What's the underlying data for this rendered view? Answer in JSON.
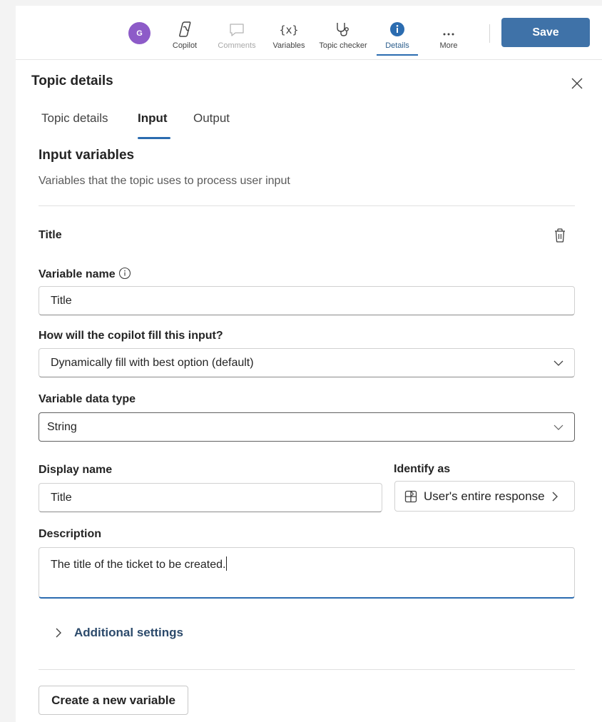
{
  "toolbar": {
    "avatar_initial": "G",
    "items": [
      {
        "label": "Copilot",
        "icon": "copilot-icon"
      },
      {
        "label": "Comments",
        "icon": "comment-icon"
      },
      {
        "label": "Variables",
        "icon": "variables-icon"
      },
      {
        "label": "Topic checker",
        "icon": "stethoscope-icon"
      },
      {
        "label": "Details",
        "icon": "info-icon"
      },
      {
        "label": "More",
        "icon": "more-icon"
      }
    ],
    "active_item": "Details",
    "disabled_item": "Comments",
    "save_label": "Save"
  },
  "panel": {
    "title": "Topic details",
    "tabs": [
      {
        "label": "Topic details"
      },
      {
        "label": "Input"
      },
      {
        "label": "Output"
      }
    ],
    "active_tab": "Input"
  },
  "input_variables": {
    "title": "Input variables",
    "description": "Variables that the topic uses to process user input"
  },
  "variable": {
    "title": "Title",
    "variable_name_label": "Variable name",
    "variable_name_value": "Title",
    "fill_label": "How will the copilot fill this input?",
    "fill_value": "Dynamically fill with best option (default)",
    "data_type_label": "Variable data type",
    "data_type_value": "String",
    "display_name_label": "Display name",
    "display_name_value": "Title",
    "identify_label": "Identify as",
    "identify_value": "User's entire response",
    "description_label": "Description",
    "description_value": "The title of the ticket to be created."
  },
  "additional_settings_label": "Additional settings",
  "create_button_label": "Create a new variable",
  "colors": {
    "accent": "#2b6cb0",
    "save_button": "#3f72a8",
    "avatar": "#8d5bc8"
  }
}
